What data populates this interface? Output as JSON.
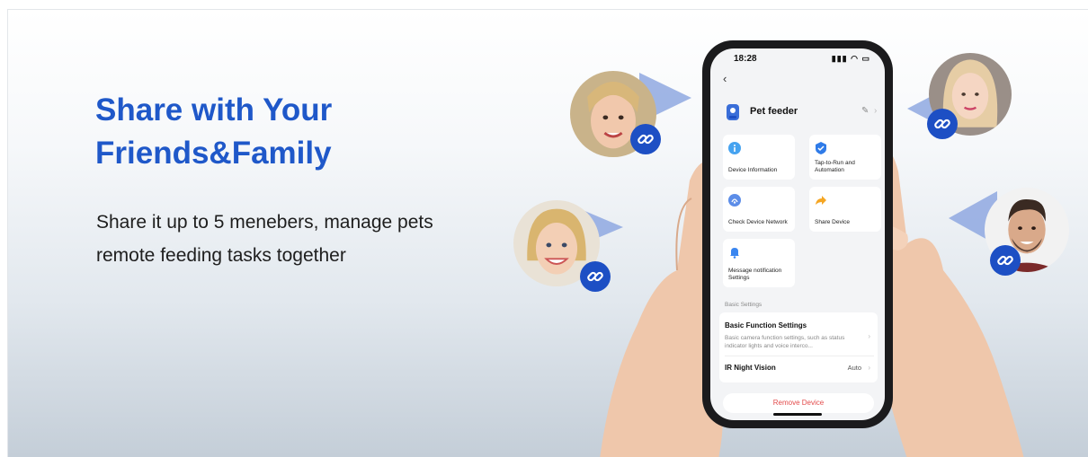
{
  "headline": {
    "line1": "Share with Your",
    "line2": "Friends&Family"
  },
  "subtext": {
    "line1": "Share it up to 5 menebers, manage pets",
    "line2": "remote feeding tasks together"
  },
  "colors": {
    "accent": "#1f58c9",
    "badge": "#1d4fc4",
    "remove": "#e34b4b"
  },
  "phone": {
    "time": "18:28",
    "status_icons": "signal-wifi-battery",
    "device_name": "Pet feeder",
    "tiles": [
      {
        "label": "Device Information",
        "icon": "info-icon"
      },
      {
        "label": "Tap-to-Run and Automation",
        "icon": "check-shield-icon"
      },
      {
        "label": "Check Device Network",
        "icon": "network-icon"
      },
      {
        "label": "Share Device",
        "icon": "share-arrow-icon"
      },
      {
        "label": "Message notification Settings",
        "icon": "bell-icon"
      }
    ],
    "section_label": "Basic Settings",
    "basic_function": {
      "title": "Basic Function Settings",
      "desc": "Basic camera function settings, such as status indicator lights and voice interco..."
    },
    "ir_night_vision": {
      "title": "IR Night Vision",
      "value": "Auto"
    },
    "remove_label": "Remove Device"
  }
}
